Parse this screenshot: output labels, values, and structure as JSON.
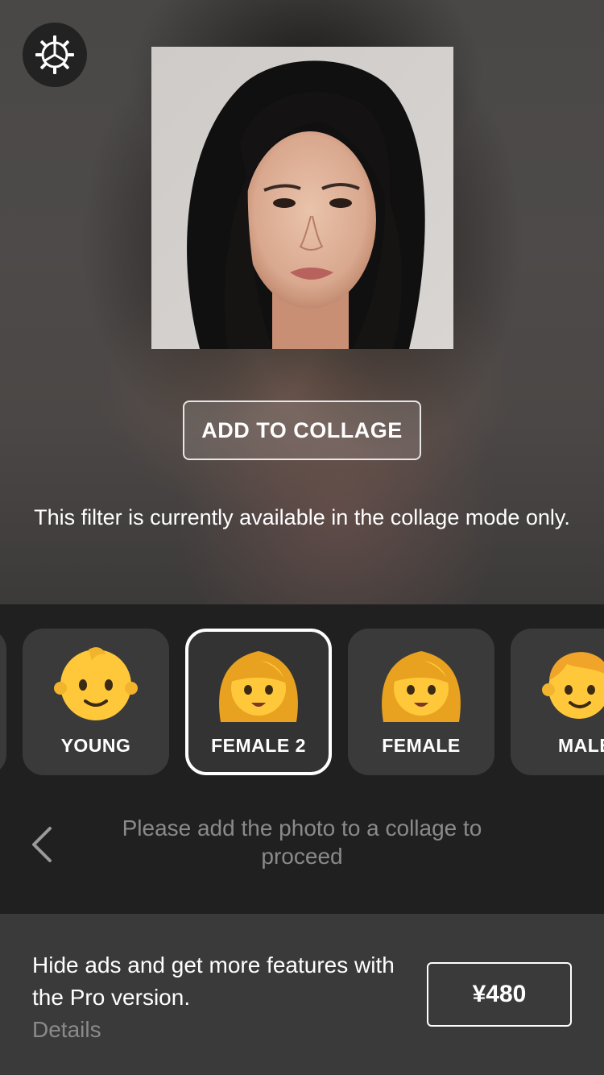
{
  "header": {
    "settings_icon": "gear-icon"
  },
  "preview": {
    "add_to_collage_label": "ADD TO COLLAGE",
    "filter_note": "This filter is currently available in the collage mode only."
  },
  "filters": {
    "items": [
      {
        "label": "YOUNG",
        "icon": "baby-emoji-icon",
        "selected": false
      },
      {
        "label": "FEMALE 2",
        "icon": "woman-emoji-icon",
        "selected": true
      },
      {
        "label": "FEMALE",
        "icon": "woman-emoji-icon",
        "selected": false
      },
      {
        "label": "MALE",
        "icon": "man-emoji-icon",
        "selected": false
      }
    ],
    "hint": "Please add the photo to a collage to proceed",
    "back_icon": "chevron-left-icon"
  },
  "pro": {
    "text": "Hide ads and get more features with the Pro version.",
    "details_label": "Details",
    "price_label": "¥480"
  },
  "colors": {
    "background": "#1f1f1f",
    "card": "#3a3a3a",
    "accent": "#ffffff",
    "muted_text": "#8a8a8a",
    "emoji_yellow": "#ffc83a"
  }
}
